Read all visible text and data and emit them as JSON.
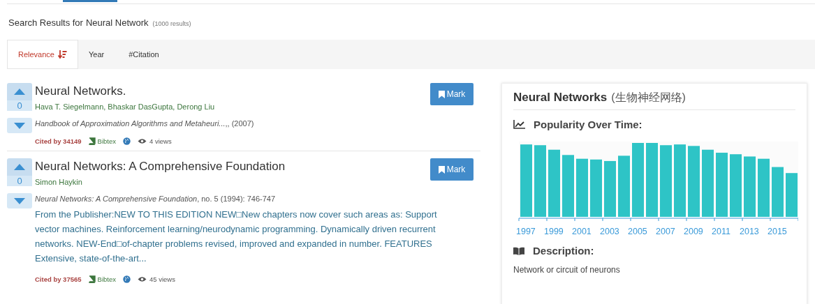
{
  "search_header": {
    "prefix": "Search Results for",
    "query": "Neural Network",
    "count": "(1000 results)"
  },
  "sort_tabs": [
    {
      "label": "Relevance",
      "selected": true
    },
    {
      "label": "Year",
      "selected": false
    },
    {
      "label": "#Citation",
      "selected": false
    }
  ],
  "results": [
    {
      "votes": "0",
      "title": "Neural Networks.",
      "authors": "Hava T. Siegelmann, Bhaskar DasGupta, Derong Liu",
      "venue": "Handbook of Approximation Algorithms and Metaheuri...",
      "venue_rest": ",, (2007)",
      "cited": "Cited by 34149",
      "bibtex": "Bibtex",
      "views": "4 views",
      "mark": "Mark"
    },
    {
      "votes": "0",
      "title": "Neural Networks: A Comprehensive Foundation",
      "authors": "Simon Haykin",
      "venue": "Neural Networks: A Comprehensive Foundation",
      "venue_rest": ", no. 5 (1994): 746-747",
      "abstract": "From the Publisher:NEW TO THIS EDITION NEW□New chapters now cover such areas as: Support vector machines. Reinforcement learning/neurodynamic programming. Dynamically driven recurrent networks. NEW-End□of-chapter problems revised, improved and expanded in number. FEATURES Extensive, state-of-the-art...",
      "cited": "Cited by 37565",
      "bibtex": "Bibtex",
      "views": "45 views",
      "mark": "Mark"
    }
  ],
  "topic_panel": {
    "title": "Neural Networks",
    "title_zh": "(生物神经网络)",
    "popularity_heading": "Popularity Over Time:",
    "chart_x_labels": [
      "1997",
      "1999",
      "2001",
      "2003",
      "2005",
      "2007",
      "2009",
      "2011",
      "2013",
      "2015"
    ],
    "description_heading": "Description:",
    "description": "Network or circuit of neurons"
  }
}
